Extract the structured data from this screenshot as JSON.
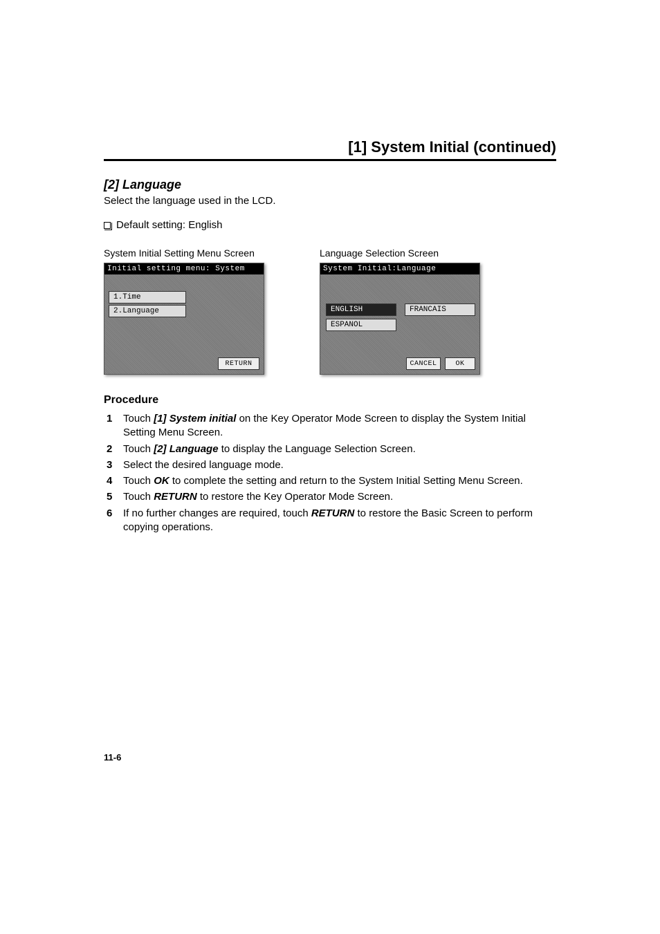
{
  "header": "[1] System Initial (continued)",
  "subheader": "[2] Language",
  "intro": "Select the language used in the LCD.",
  "default_setting": "Default setting: English",
  "screens": {
    "left": {
      "label": "System Initial Setting Menu Screen",
      "title": "Initial setting menu: System",
      "options": [
        "1.Time",
        "2.Language"
      ],
      "return_btn": "RETURN"
    },
    "right": {
      "label": "Language Selection Screen",
      "title": "System Initial:Language",
      "options": [
        "ENGLISH",
        "FRANCAIS",
        "ESPANOL"
      ],
      "cancel_btn": "CANCEL",
      "ok_btn": "OK"
    }
  },
  "procedure_header": "Procedure",
  "procedure": [
    {
      "pre": "Touch ",
      "em": "[1] System initial",
      "post": " on the Key Operator Mode Screen to display the System Initial Setting Menu Screen."
    },
    {
      "pre": "Touch ",
      "em": "[2] Language",
      "post": " to display the Language Selection Screen."
    },
    {
      "pre": "Select the desired language mode.",
      "em": "",
      "post": ""
    },
    {
      "pre": "Touch ",
      "em": "OK",
      "post": " to complete the setting and return to the System Initial Setting Menu Screen."
    },
    {
      "pre": "Touch ",
      "em": "RETURN",
      "post": " to restore the Key Operator Mode Screen."
    },
    {
      "pre": "If no further changes are required, touch ",
      "em": "RETURN",
      "post": " to restore the Basic Screen to perform copying operations."
    }
  ],
  "page_number": "11-6"
}
